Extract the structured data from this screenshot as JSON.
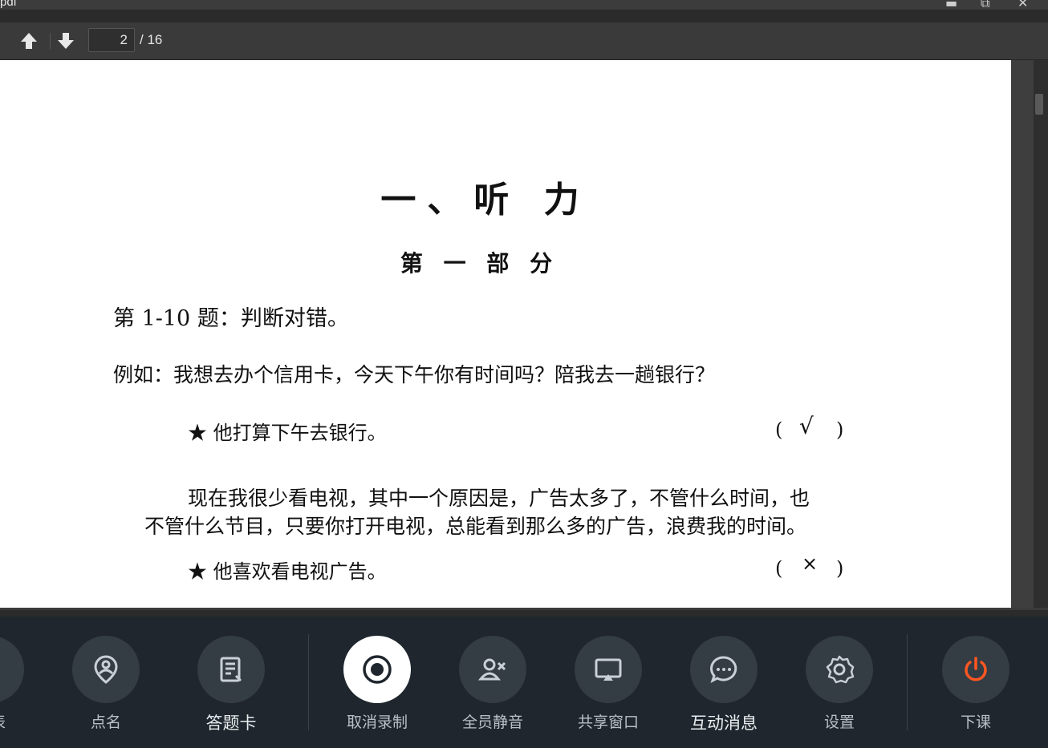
{
  "window": {
    "title": "pdf"
  },
  "toolbar": {
    "current_page": "2",
    "total_pages": "/ 16"
  },
  "document": {
    "heading": "一、听 力",
    "subheading": "第 一 部 分",
    "instruction": "第 1-10 题：判断对错。",
    "example_line": "例如：我想去办个信用卡，今天下午你有时间吗？陪我去一趟银行？",
    "items": [
      {
        "statement": "★ 他打算下午去银行。",
        "answer": "√"
      },
      {
        "statement": "★ 他喜欢看电视广告。",
        "answer": "×"
      }
    ],
    "paragraph": [
      "现在我很少看电视，其中一个原因是，广告太多了，不管什么时间，也",
      "不管什么节目，只要你打开电视，总能看到那么多的广告，浪费我的时间。"
    ],
    "paren_open": "(",
    "paren_close": ")"
  },
  "bottombar": {
    "items": [
      {
        "label": "列表",
        "icon": "list-icon"
      },
      {
        "label": "点名",
        "icon": "location-person-icon"
      },
      {
        "label": "答题卡",
        "icon": "answer-card-icon"
      },
      {
        "label": "取消录制",
        "icon": "record-icon"
      },
      {
        "label": "全员静音",
        "icon": "mute-all-icon"
      },
      {
        "label": "共享窗口",
        "icon": "share-screen-icon"
      },
      {
        "label": "互动消息",
        "icon": "chat-icon"
      },
      {
        "label": "设置",
        "icon": "gear-icon"
      },
      {
        "label": "下课",
        "icon": "power-icon"
      }
    ],
    "power_color": "#ff5722"
  }
}
